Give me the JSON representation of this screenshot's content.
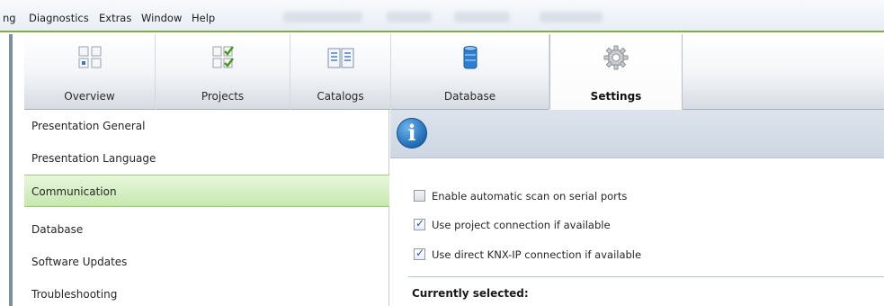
{
  "menubar": {
    "items": [
      {
        "label": "ng"
      },
      {
        "label": "Diagnostics"
      },
      {
        "label": "Extras"
      },
      {
        "label": "Window"
      },
      {
        "label": "Help"
      }
    ],
    "accent_color": "#7fae45"
  },
  "toolbar": {
    "tabs": [
      {
        "label": "Overview",
        "icon": "overview-icon"
      },
      {
        "label": "Projects",
        "icon": "projects-icon"
      },
      {
        "label": "Catalogs",
        "icon": "catalogs-icon"
      },
      {
        "label": "Database",
        "icon": "database-icon"
      },
      {
        "label": "Settings",
        "icon": "gear-icon",
        "active": true
      }
    ]
  },
  "nav": {
    "items": [
      {
        "label": "Presentation General"
      },
      {
        "label": "Presentation Language"
      },
      {
        "label": "Communication",
        "selected": true
      },
      {
        "label": "Database"
      },
      {
        "label": "Software Updates"
      },
      {
        "label": "Troubleshooting"
      }
    ],
    "selected_color": "#c6e8ad"
  },
  "panel": {
    "info_icon": "info-icon",
    "options": [
      {
        "label": "Enable automatic scan on serial ports",
        "checked": false
      },
      {
        "label": "Use project connection if available",
        "checked": true
      },
      {
        "label": "Use direct KNX-IP connection if available",
        "checked": true
      }
    ],
    "section_title": "Currently selected:"
  }
}
